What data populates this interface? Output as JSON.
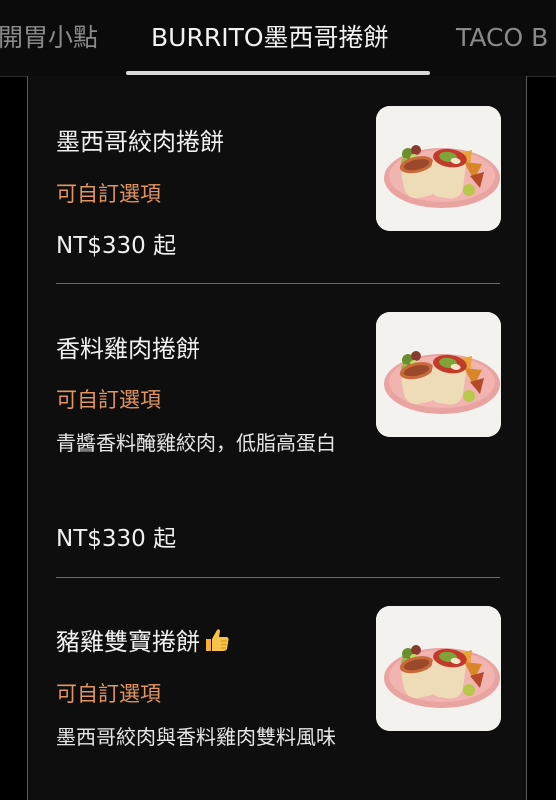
{
  "tabs": [
    {
      "label": "開胃小點",
      "active": false
    },
    {
      "label": "BURRITO墨西哥捲餅",
      "active": true
    },
    {
      "label": "TACO B",
      "active": false
    }
  ],
  "items": [
    {
      "name": "墨西哥絞肉捲餅",
      "option": "可自訂選項",
      "description": "",
      "price": "NT$330 起",
      "image": "burrito-plate-photo"
    },
    {
      "name": "香料雞肉捲餅",
      "option": "可自訂選項",
      "description": "青醬香料醃雞絞肉，低脂高蛋白",
      "price": "NT$330 起",
      "image": "burrito-plate-photo"
    },
    {
      "name": "豬雞雙寶捲餅",
      "name_icon": "thumbs-up-icon",
      "option": "可自訂選項",
      "description": "墨西哥絞肉與香料雞肉雙料風味",
      "price": "",
      "image": "burrito-plate-photo"
    }
  ],
  "colors": {
    "background": "#000000",
    "panel": "#0e0e0e",
    "option_accent": "#e3955f",
    "text": "#f0f0f0",
    "tab_inactive": "#8a8a8a"
  }
}
